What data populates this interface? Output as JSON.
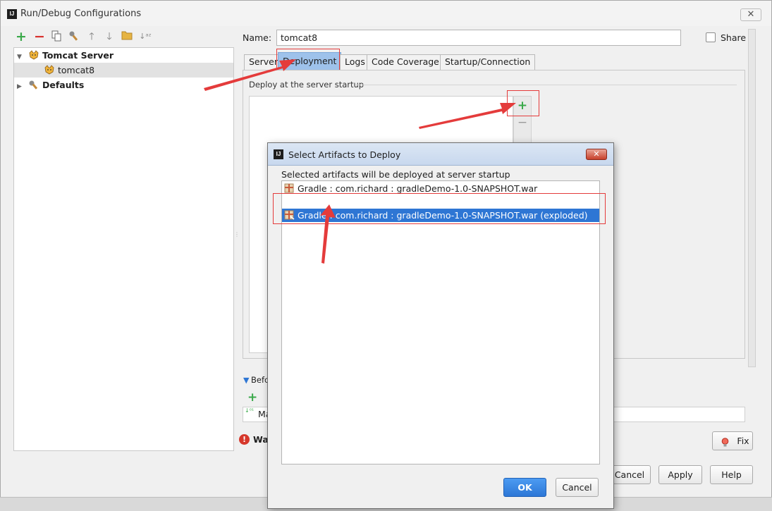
{
  "window": {
    "title": "Run/Debug Configurations",
    "close_glyph": "✕"
  },
  "toolbar": {
    "icons": [
      "add-icon",
      "remove-icon",
      "copy-icon",
      "edit-defaults-icon",
      "move-up-icon",
      "move-down-icon",
      "folder-icon",
      "sort-icon"
    ]
  },
  "tree": {
    "items": [
      {
        "label": "Tomcat Server",
        "bold": true
      },
      {
        "label": "tomcat8",
        "selected": true
      },
      {
        "label": "Defaults",
        "bold": true
      }
    ]
  },
  "form": {
    "name_label": "Name:",
    "name_value": "tomcat8",
    "share_label": "Share",
    "share_checked": false
  },
  "tabs": [
    {
      "label": "Server"
    },
    {
      "label": "Deployment",
      "active": true
    },
    {
      "label": "Logs"
    },
    {
      "label": "Code Coverage"
    },
    {
      "label": "Startup/Connection"
    }
  ],
  "deployment": {
    "section_label": "Deploy at the server startup",
    "add_glyph": "+",
    "remove_glyph": "−"
  },
  "before_launch": {
    "label_partial": "Befo",
    "item_partial": "Ma"
  },
  "warning": {
    "label_partial": "Wa",
    "fix_label": "Fix"
  },
  "footer": {
    "cancel_label": "Cancel",
    "apply_label": "Apply",
    "help_label": "Help"
  },
  "dialog": {
    "title": "Select Artifacts to Deploy",
    "close_glyph": "✕",
    "description": "Selected artifacts will be deployed at server startup",
    "artifacts": [
      {
        "label": "Gradle : com.richard : gradleDemo-1.0-SNAPSHOT.war",
        "selected": false
      },
      {
        "label": "Gradle : com.richard : gradleDemo-1.0-SNAPSHOT.war (exploded)",
        "selected": true
      }
    ],
    "ok_label": "OK",
    "cancel_label": "Cancel"
  },
  "colors": {
    "selection": "#2e76d4",
    "annotation_red": "#e43b3b",
    "active_tab": "#9ec2eb",
    "add_green": "#3aa94a"
  }
}
